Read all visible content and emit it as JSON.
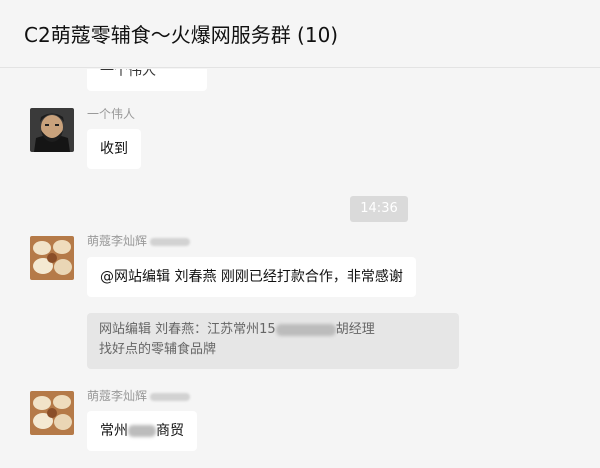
{
  "window": {
    "title": "C2萌蔻零辅食～火爆网服务群 (10)"
  },
  "messages": {
    "partial_top": {
      "text": "一个伟人"
    },
    "m1": {
      "sender": "一个伟人",
      "text": "收到"
    },
    "time_divider": "14:36",
    "m2": {
      "sender": "萌蔻李灿辉",
      "text": "@网站编辑 刘春燕 刚刚已经打款合作，非常感谢",
      "quote_line1_a": "网站编辑 刘春燕：江苏常州15",
      "quote_line1_b": "胡经理",
      "quote_line2": "找好点的零辅食品牌"
    },
    "m3": {
      "sender": "萌蔻李灿辉",
      "text_a": "常州",
      "text_b": "商贸"
    }
  },
  "colors": {
    "background": "#f5f5f5",
    "bubble": "#ffffff",
    "quote": "#e6e6e6",
    "time_badge": "#dadada"
  }
}
